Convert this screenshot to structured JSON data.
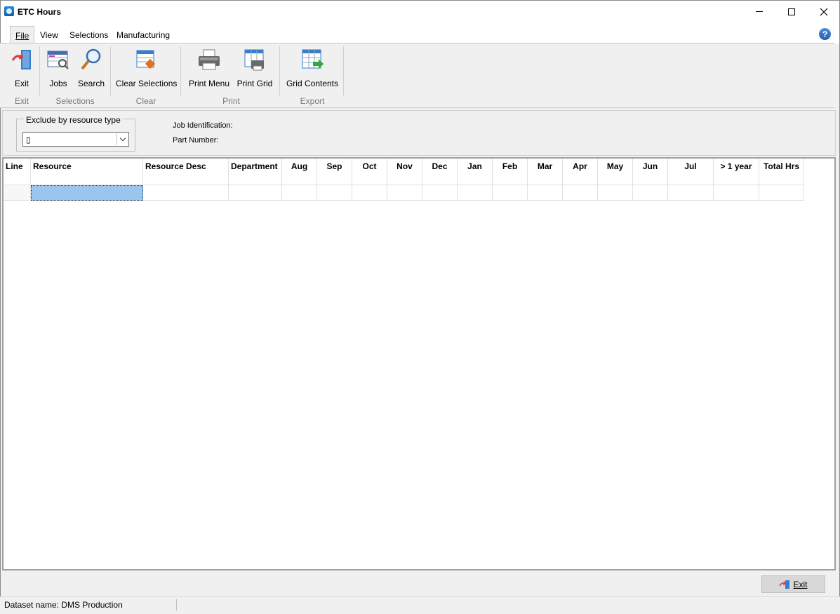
{
  "window": {
    "title": "ETC Hours"
  },
  "menu": {
    "tabs": [
      {
        "label": "File",
        "active": true
      },
      {
        "label": "View",
        "active": false
      },
      {
        "label": "Selections",
        "active": false
      },
      {
        "label": "Manufacturing",
        "active": false
      }
    ],
    "help_icon": "question-icon",
    "help_text": "?"
  },
  "ribbon": {
    "buttons": {
      "exit": {
        "label": "Exit",
        "icon": "exit-door-icon"
      },
      "jobs": {
        "label": "Jobs",
        "icon": "jobs-icon"
      },
      "search": {
        "label": "Search",
        "icon": "magnifier-icon"
      },
      "clear_selections": {
        "label": "Clear Selections",
        "icon": "clear-selections-icon"
      },
      "print_menu": {
        "label": "Print Menu",
        "icon": "printer-icon"
      },
      "print_grid": {
        "label": "Print Grid",
        "icon": "print-grid-icon"
      },
      "grid_contents": {
        "label": "Grid Contents",
        "icon": "export-grid-icon"
      }
    },
    "groups": {
      "exit": "Exit",
      "selections": "Selections",
      "clear": "Clear",
      "print": "Print",
      "export": "Export"
    }
  },
  "filters": {
    "exclude_group_label": "Exclude by resource type",
    "exclude_value": "▯",
    "job_identification_label": "Job Identification:",
    "part_number_label": "Part Number:"
  },
  "grid": {
    "columns": [
      "Line",
      "Resource",
      "Resource Desc",
      "Department",
      "Aug",
      "Sep",
      "Oct",
      "Nov",
      "Dec",
      "Jan",
      "Feb",
      "Mar",
      "Apr",
      "May",
      "Jun",
      "Jul",
      "> 1 year",
      "Total Hrs"
    ],
    "rows": [
      {
        "line": "",
        "resource": "",
        "resource_desc": "",
        "department": "",
        "aug": "",
        "sep": "",
        "oct": "",
        "nov": "",
        "dec": "",
        "jan": "",
        "feb": "",
        "mar": "",
        "apr": "",
        "may": "",
        "jun": "",
        "jul": "",
        "over_year": "",
        "total": ""
      }
    ]
  },
  "footer": {
    "exit_label": "Exit",
    "exit_icon": "exit-icon"
  },
  "status": {
    "dataset": "Dataset name:  DMS Production"
  },
  "colors": {
    "selection": "#99c5ee",
    "accent": "#1e5fb8"
  }
}
